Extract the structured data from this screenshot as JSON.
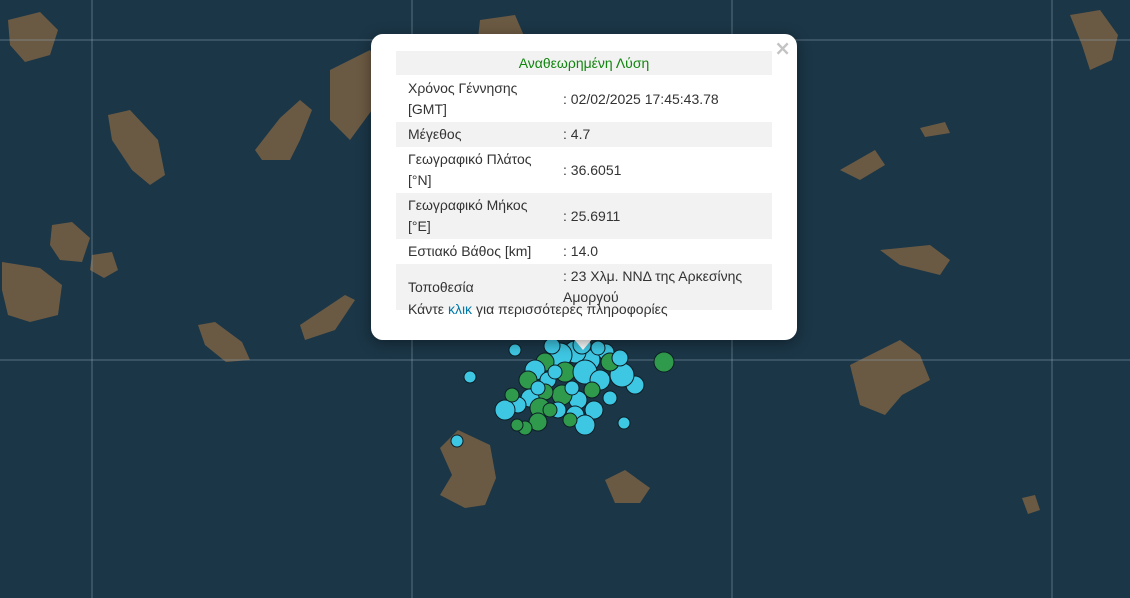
{
  "map": {
    "colors": {
      "sea": "#1b3647",
      "land": "#6b5a43",
      "grid": "#8aa0b0",
      "quake_cyan": "#3ec7e3",
      "quake_green": "#2f9a4c"
    }
  },
  "popup": {
    "close_symbol": "×",
    "title": "Αναθεωρημένη Λύση",
    "rows": [
      {
        "label": "Χρόνος Γέννησης [GMT]",
        "value": ": 02/02/2025 17:45:43.78"
      },
      {
        "label": "Μέγεθος",
        "value": ": 4.7"
      },
      {
        "label": "Γεωγραφικό Πλάτος [°N]",
        "value": ": 36.6051"
      },
      {
        "label": "Γεωγραφικό Μήκος [°E]",
        "value": ": 25.6911"
      },
      {
        "label": "Εστιακό Βάθος [km]",
        "value": ": 14.0"
      },
      {
        "label": "Τοποθεσία",
        "value": ": 23 Χλμ. ΝΝΔ της Αρκεσίνης Αμοργού"
      }
    ],
    "footer_prefix": "Κάντε",
    "footer_link": "κλικ",
    "footer_suffix": "για περισσότερες πληροφορίες"
  }
}
